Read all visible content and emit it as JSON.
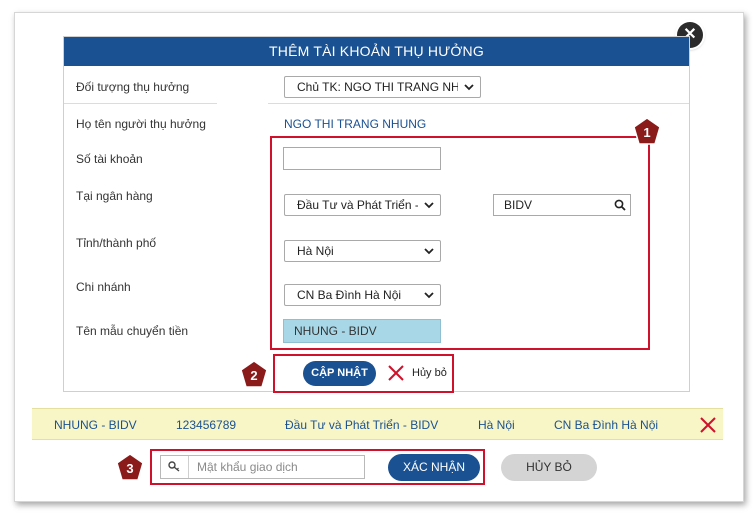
{
  "dialog": {
    "title": "THÊM TÀI KHOẢN THỤ HƯỞNG"
  },
  "form": {
    "beneficiary_type_label": "Đối tượng thụ hưởng",
    "beneficiary_type_value": "Chủ TK: NGO THI TRANG NHU",
    "beneficiary_name_label": "Họ tên người thụ hưởng",
    "beneficiary_name_value": "NGO THI TRANG NHUNG",
    "account_number_label": "Số tài khoản",
    "account_number_value": "",
    "bank_label": "Tại ngân hàng",
    "bank_value": "Đầu Tư và Phát Triển - B",
    "bank_search_value": "BIDV",
    "province_label": "Tỉnh/thành phố",
    "province_value": "Hà Nội",
    "branch_label": "Chi nhánh",
    "branch_value": "CN Ba Đình Hà Nội",
    "template_label": "Tên mẫu chuyển tiền",
    "template_value": "NHUNG - BIDV"
  },
  "actions": {
    "update_label": "CẬP NHẬT",
    "cancel_label": "Hủy bỏ"
  },
  "result_row": {
    "template": "NHUNG - BIDV",
    "account": "123456789",
    "bank": "Đầu Tư và Phát Triển - BIDV",
    "province": "Hà Nội",
    "branch": "CN Ba Đình Hà Nội"
  },
  "confirm": {
    "password_placeholder": "Mật khẩu giao dịch",
    "confirm_label": "XÁC NHẬN",
    "cancel_label": "HỦY BỎ"
  },
  "badges": {
    "one": "1",
    "two": "2",
    "three": "3"
  },
  "colors": {
    "primary": "#1a5192",
    "highlight_red": "#d0112b",
    "badge": "#8b1a1a",
    "result_row_bg": "#f8f6c7",
    "template_bg": "#a8d8e8"
  },
  "icons": {
    "close": "close-icon",
    "chevron": "chevron-down-icon",
    "search": "search-icon",
    "cancel": "x-icon",
    "delete": "delete-icon",
    "key": "key-icon"
  }
}
